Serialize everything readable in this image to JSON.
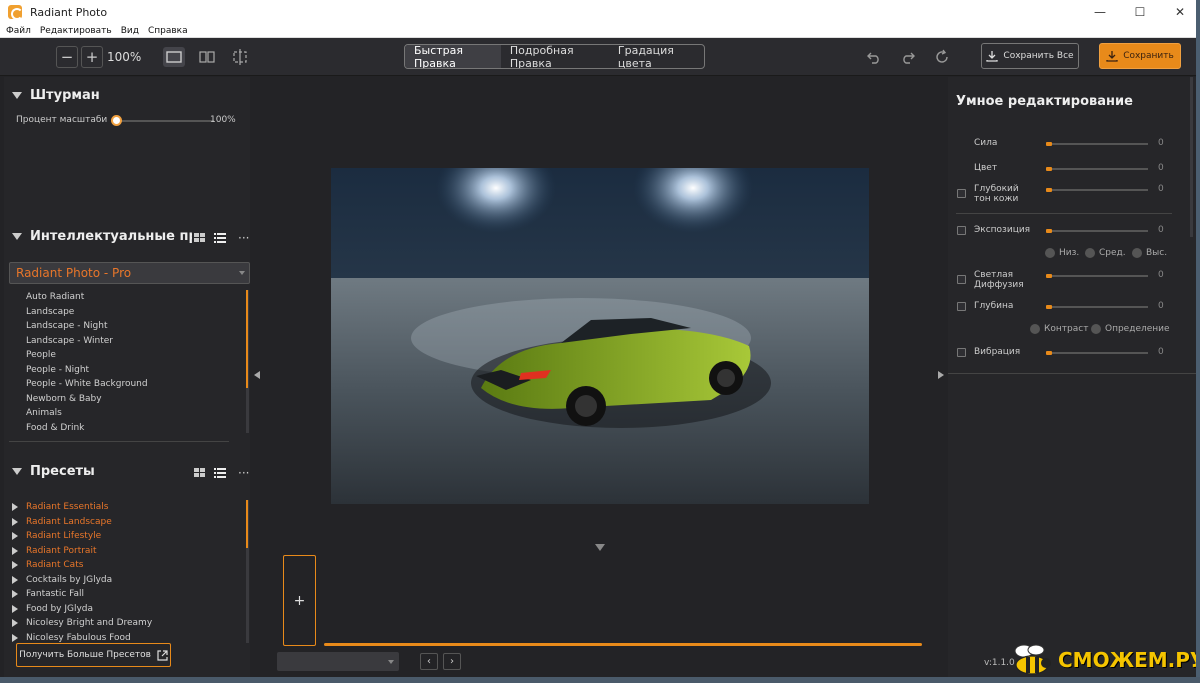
{
  "window": {
    "title": "Radiant Photo",
    "minimize": "—",
    "maximize": "☐",
    "close": "✕"
  },
  "menu": [
    "Файл",
    "Редактировать",
    "Вид",
    "Справка"
  ],
  "toolbar": {
    "zoom_out": "−",
    "zoom_in": "+",
    "zoom_value": "100%",
    "tabs": [
      "Быстрая Правка",
      "Подробная Правка",
      "Градация цвета"
    ],
    "active_tab": 0,
    "save_all_label": "Сохранить Все",
    "save_label": "Сохранить"
  },
  "navigator": {
    "title": "Штурман",
    "zoom_label": "Процент масштабиро",
    "zoom_value": "100%"
  },
  "smart_presets": {
    "title": "Интеллектуальные пресе",
    "selected": "Radiant Photo - Pro",
    "items": [
      "Auto Radiant",
      "Landscape",
      "Landscape - Night",
      "Landscape - Winter",
      "People",
      "People - Night",
      "People - White Background",
      "Newborn & Baby",
      "Animals",
      "Food & Drink"
    ]
  },
  "presets": {
    "title": "Пресеты",
    "items": [
      {
        "label": "Radiant Essentials",
        "color": "#e8762a"
      },
      {
        "label": "Radiant Landscape",
        "color": "#e8762a"
      },
      {
        "label": "Radiant Lifestyle",
        "color": "#e8762a"
      },
      {
        "label": "Radiant Portrait",
        "color": "#e8762a"
      },
      {
        "label": "Radiant Cats",
        "color": "#e8762a"
      },
      {
        "label": "Cocktails by JGlyda",
        "color": "#d0d0d0"
      },
      {
        "label": "Fantastic Fall",
        "color": "#d0d0d0"
      },
      {
        "label": "Food by JGlyda",
        "color": "#d0d0d0"
      },
      {
        "label": "Nicolesy Bright and Dreamy",
        "color": "#d0d0d0"
      },
      {
        "label": "Nicolesy Fabulous Food",
        "color": "#d0d0d0"
      }
    ],
    "more_label": "Получить Больше Пресетов"
  },
  "filmstrip": {
    "add_label": "+",
    "prev": "‹",
    "next": "›"
  },
  "smart_edit": {
    "title": "Умное редактирование",
    "rows": [
      {
        "label": "Сила",
        "value": "0",
        "checkbox": false
      },
      {
        "label": "Цвет",
        "value": "0",
        "checkbox": false
      },
      {
        "label": "Глубокий тон кожи",
        "value": "0",
        "checkbox": true
      }
    ],
    "exposure": {
      "label": "Экспозиция",
      "value": "0",
      "options": [
        "Низ.",
        "Сред.",
        "Выс."
      ]
    },
    "diffusion": {
      "label": "Светлая Диффузия",
      "value": "0"
    },
    "depth": {
      "label": "Глубина",
      "value": "0",
      "options": [
        "Контраст",
        "Определение"
      ]
    },
    "vibrance": {
      "label": "Вибрация",
      "value": "0"
    }
  },
  "version": "v:1.1.0",
  "watermark": "СМОЖЕМ.РУ",
  "colors": {
    "accent": "#e88a1a",
    "preset_orange": "#e8762a",
    "panel": "#262629",
    "canvas": "#232326"
  }
}
